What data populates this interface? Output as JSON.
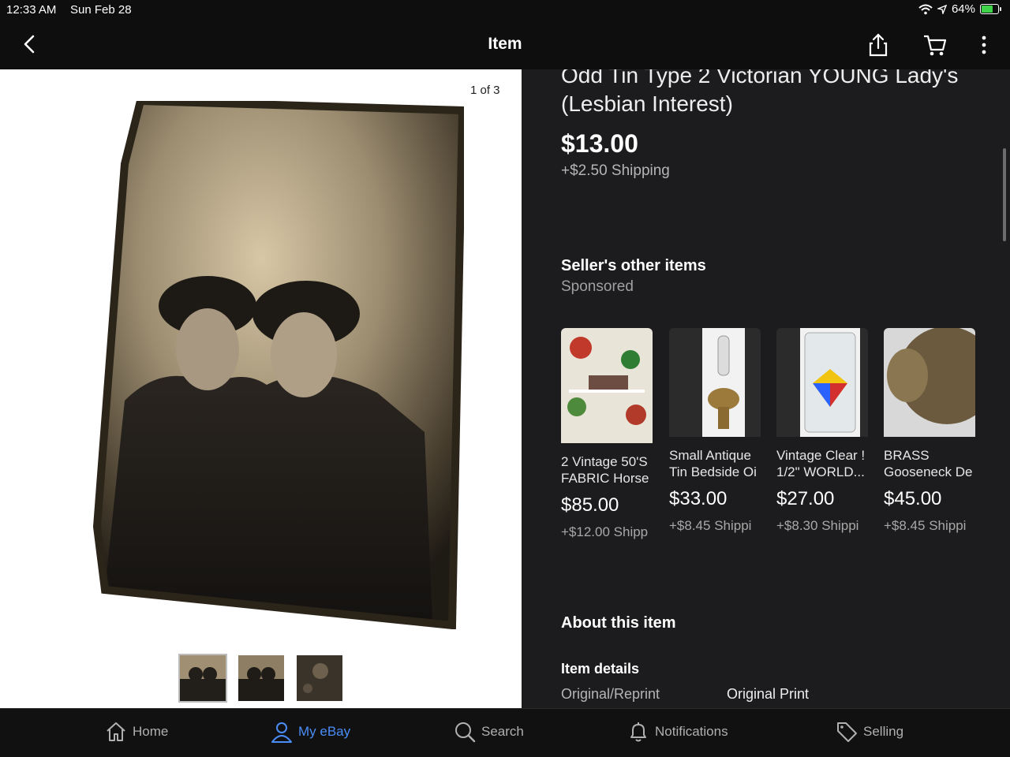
{
  "status_bar": {
    "time": "12:33 AM",
    "date": "Sun Feb 28",
    "battery": "64%"
  },
  "nav": {
    "title": "Item"
  },
  "gallery": {
    "counter": "1 of 3",
    "thumb_count": 3
  },
  "item": {
    "title": "Odd Tin Type 2 Victorian YOUNG Lady's (Lesbian Interest)",
    "price": "$13.00",
    "shipping": "+$2.50 Shipping"
  },
  "sellers_other": {
    "heading": "Seller's other items",
    "sponsored": "Sponsored",
    "cards": [
      {
        "title1": "2 Vintage 50'S",
        "title2": "FABRIC Horse",
        "price": "$85.00",
        "shipping": "+$12.00 Shipp"
      },
      {
        "title1": "Small Antique",
        "title2": "Tin Bedside Oi",
        "price": "$33.00",
        "shipping": "+$8.45 Shippi"
      },
      {
        "title1": "Vintage Clear !",
        "title2": "1/2\" WORLD...",
        "price": "$27.00",
        "shipping": "+$8.30 Shippi"
      },
      {
        "title1": "BRASS",
        "title2": "Gooseneck De",
        "price": "$45.00",
        "shipping": "+$8.45 Shippi"
      }
    ]
  },
  "about": {
    "heading": "About this item",
    "details_heading": "Item details",
    "key": "Original/Reprint",
    "value": "Original Print"
  },
  "tabs": [
    {
      "label": "Home",
      "icon": "home-icon"
    },
    {
      "label": "My eBay",
      "icon": "person-icon"
    },
    {
      "label": "Search",
      "icon": "search-icon"
    },
    {
      "label": "Notifications",
      "icon": "bell-icon"
    },
    {
      "label": "Selling",
      "icon": "tag-icon"
    }
  ],
  "colors": {
    "accent": "#4a8df6",
    "panel": "#1c1c1e",
    "battery": "#3fd34a"
  }
}
